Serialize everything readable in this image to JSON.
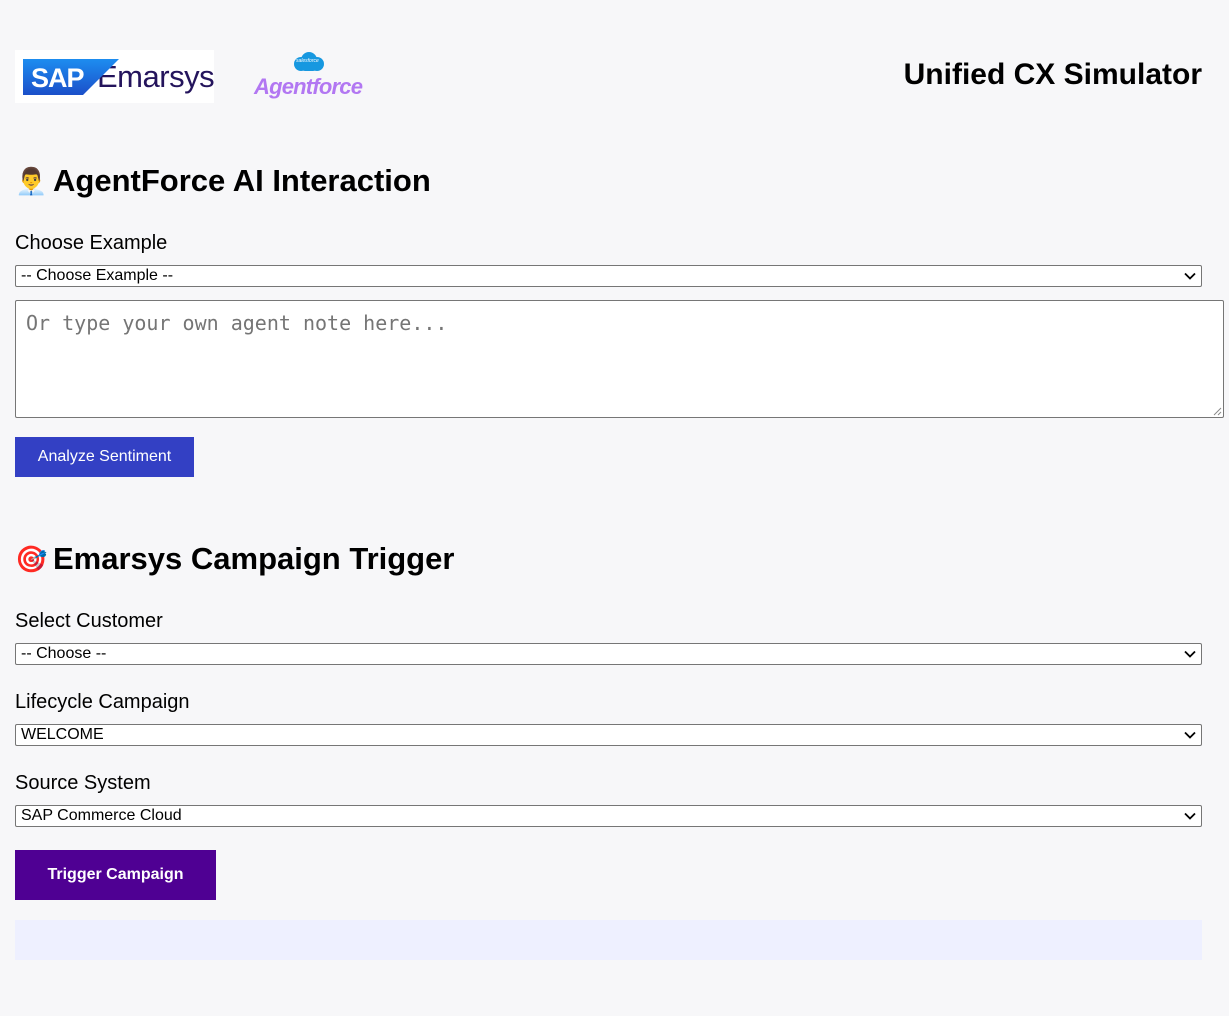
{
  "header": {
    "logo_sap_text": "SAP",
    "logo_emarsys_text": "Emarsys",
    "logo_salesforce_text": "salesforce",
    "logo_agentforce_text": "Agentforce",
    "app_title": "Unified CX Simulator"
  },
  "agentforce": {
    "icon": "👨‍💼",
    "title": "AgentForce AI Interaction",
    "example_label": "Choose Example",
    "example_selected": "-- Choose Example --",
    "note_placeholder": "Or type your own agent note here...",
    "analyze_button": "Analyze Sentiment"
  },
  "campaign": {
    "icon": "🎯",
    "title": "Emarsys Campaign Trigger",
    "customer_label": "Select Customer",
    "customer_selected": "-- Choose --",
    "lifecycle_label": "Lifecycle Campaign",
    "lifecycle_selected": "WELCOME",
    "source_label": "Source System",
    "source_selected": "SAP Commerce Cloud",
    "trigger_button": "Trigger Campaign",
    "result_text": ""
  },
  "colors": {
    "analyze_button": "#3340c4",
    "trigger_button": "#4f0093",
    "result_box": "#eef0ff",
    "agentforce_logo": "#b277f2",
    "emarsys_logo": "#24145c",
    "background": "#f7f7f9"
  }
}
